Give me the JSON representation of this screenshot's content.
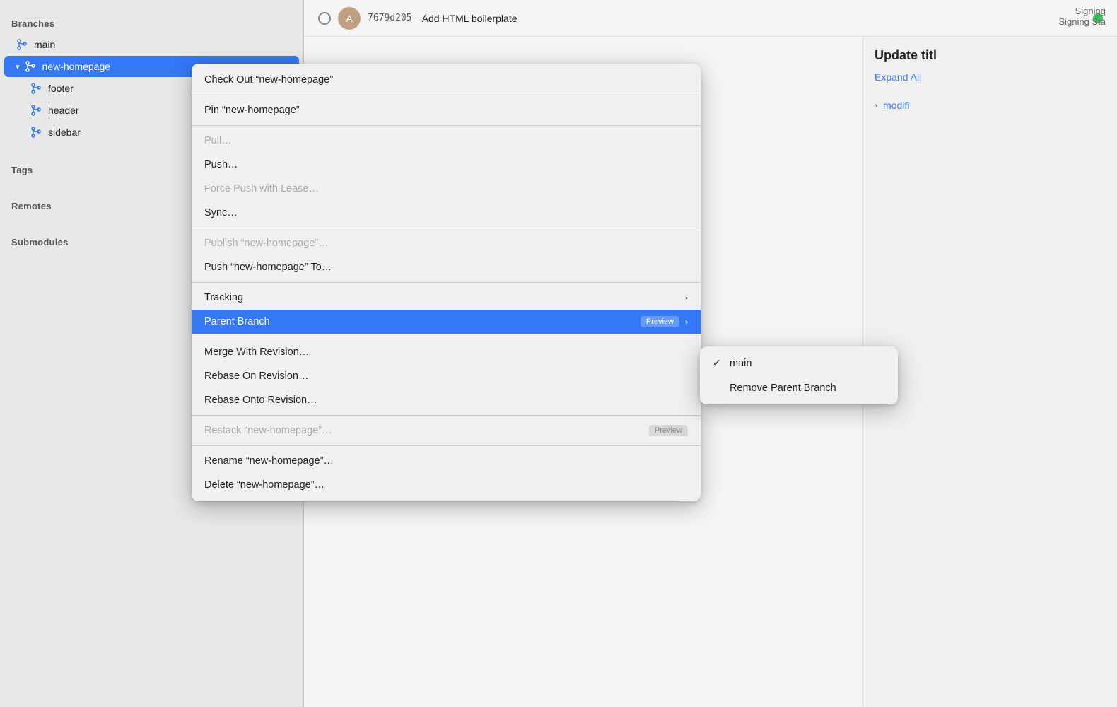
{
  "sidebar": {
    "branches_label": "Branches",
    "tags_label": "Tags",
    "remotes_label": "Remotes",
    "submodules_label": "Submodules",
    "branches": [
      {
        "name": "main",
        "active": false
      },
      {
        "name": "new-homepage",
        "active": true
      },
      {
        "name": "footer",
        "active": false,
        "child": true
      },
      {
        "name": "header",
        "active": false,
        "child": true
      },
      {
        "name": "sidebar",
        "active": false,
        "child": true
      }
    ]
  },
  "commit": {
    "hash": "7679d205",
    "message": "Add HTML boilerplate",
    "avatar_letter": "A"
  },
  "detail": {
    "title": "Update titl",
    "expand_all": "Expand All",
    "modified_label": "modifi"
  },
  "signing": {
    "line1": "Signing",
    "line2": "Signing Sta"
  },
  "context_menu": {
    "items": [
      {
        "id": "checkout",
        "label": "Check Out “new-homepage”",
        "disabled": false,
        "separator_after": true
      },
      {
        "id": "pin",
        "label": "Pin “new-homepage”",
        "disabled": false,
        "separator_after": true
      },
      {
        "id": "pull",
        "label": "Pull…",
        "disabled": true,
        "separator_after": false
      },
      {
        "id": "push",
        "label": "Push…",
        "disabled": false,
        "separator_after": false
      },
      {
        "id": "force-push",
        "label": "Force Push with Lease…",
        "disabled": true,
        "separator_after": false
      },
      {
        "id": "sync",
        "label": "Sync…",
        "disabled": false,
        "separator_after": true
      },
      {
        "id": "publish",
        "label": "Publish “new-homepage”…",
        "disabled": true,
        "separator_after": false
      },
      {
        "id": "push-to",
        "label": "Push “new-homepage” To…",
        "disabled": false,
        "separator_after": true
      },
      {
        "id": "tracking",
        "label": "Tracking",
        "disabled": false,
        "has_arrow": true,
        "separator_after": false
      },
      {
        "id": "parent-branch",
        "label": "Parent Branch",
        "disabled": false,
        "highlighted": true,
        "has_arrow": true,
        "preview": true,
        "separator_after": false
      },
      {
        "id": "merge",
        "label": "Merge With Revision…",
        "disabled": false,
        "separator_after": false
      },
      {
        "id": "rebase-on",
        "label": "Rebase On Revision…",
        "disabled": false,
        "separator_after": false
      },
      {
        "id": "rebase-onto",
        "label": "Rebase Onto Revision…",
        "disabled": false,
        "separator_after": true
      },
      {
        "id": "restack",
        "label": "Restack “new-homepage”…",
        "disabled": true,
        "preview": true,
        "separator_after": true
      },
      {
        "id": "rename",
        "label": "Rename “new-homepage”…",
        "disabled": false,
        "separator_after": false
      },
      {
        "id": "delete",
        "label": "Delete “new-homepage”…",
        "disabled": false,
        "separator_after": false
      }
    ]
  },
  "submenu": {
    "items": [
      {
        "id": "main",
        "label": "main",
        "checked": true
      },
      {
        "id": "remove",
        "label": "Remove Parent Branch",
        "checked": false
      }
    ]
  }
}
